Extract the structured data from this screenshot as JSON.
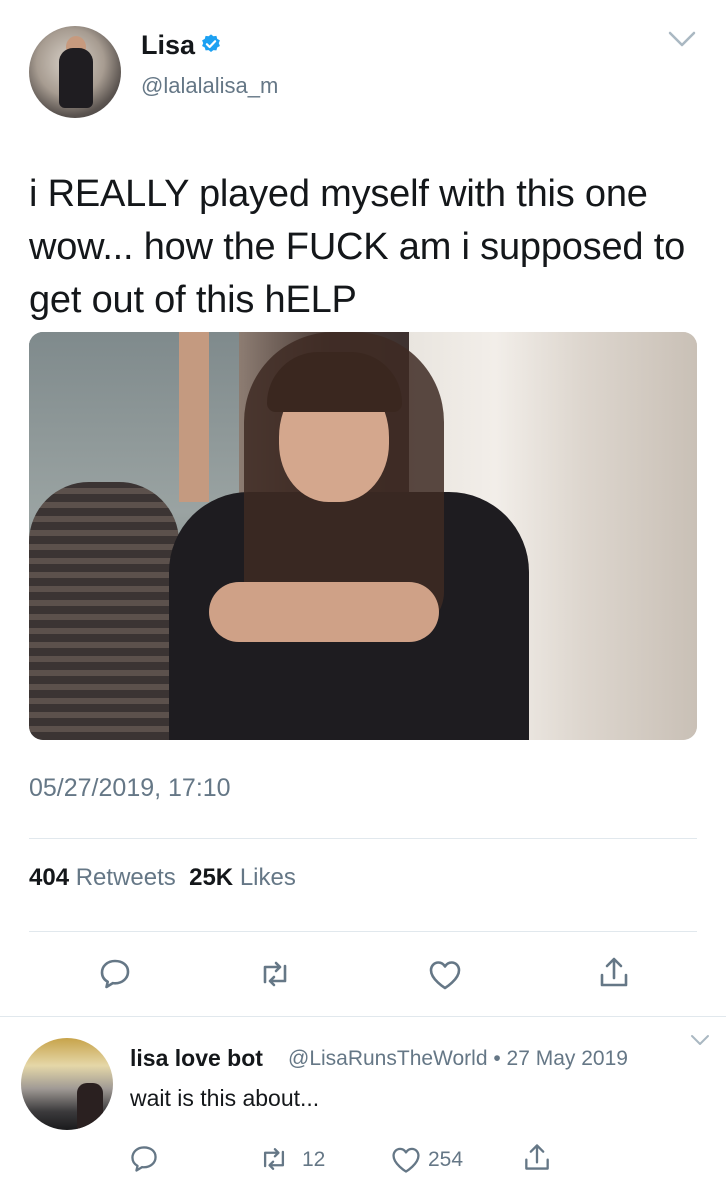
{
  "tweet": {
    "display_name": "Lisa",
    "handle": "@lalalalisa_m",
    "text": "i REALLY played myself with this one wow... how the FUCK am i supposed to get out of this hELP",
    "timestamp": "05/27/2019, 17:10",
    "retweets_count": "404",
    "retweets_label": "Retweets",
    "likes_count": "25K",
    "likes_label": "Likes"
  },
  "reply": {
    "display_name": "lisa love bot",
    "meta": "@LisaRunsTheWorld • 27 May 2019",
    "text": "wait is this about...",
    "retweets_count": "12",
    "likes_count": "254"
  },
  "colors": {
    "text": "#14171a",
    "secondary": "#657786",
    "verified": "#1da1f2",
    "divider": "#e1e8ed"
  },
  "icons": {
    "header": [
      "verified-icon",
      "chevron-down-icon"
    ],
    "tweet_actions": [
      "reply-icon",
      "retweet-icon",
      "like-icon",
      "share-icon"
    ],
    "reply_actions": [
      "reply-icon",
      "retweet-icon",
      "like-icon",
      "share-icon"
    ]
  }
}
